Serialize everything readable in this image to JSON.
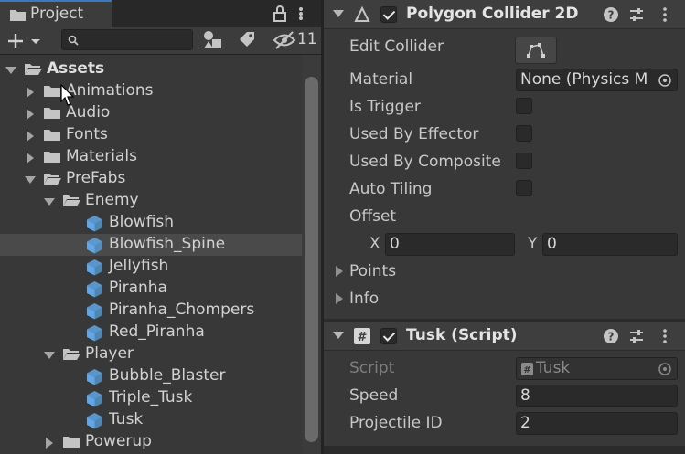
{
  "project": {
    "tab_title": "Project",
    "hidden_count": "11",
    "search_placeholder": "",
    "tree": [
      {
        "label": "Assets",
        "type": "folder",
        "expanded": true,
        "depth": 0,
        "bold": true
      },
      {
        "label": "Animations",
        "type": "folder",
        "expanded": false,
        "depth": 1
      },
      {
        "label": "Audio",
        "type": "folder",
        "expanded": false,
        "depth": 1
      },
      {
        "label": "Fonts",
        "type": "folder",
        "expanded": false,
        "depth": 1
      },
      {
        "label": "Materials",
        "type": "folder",
        "expanded": false,
        "depth": 1
      },
      {
        "label": "PreFabs",
        "type": "folder",
        "expanded": true,
        "depth": 1
      },
      {
        "label": "Enemy",
        "type": "folder",
        "expanded": true,
        "depth": 2
      },
      {
        "label": "Blowfish",
        "type": "prefab",
        "depth": 3
      },
      {
        "label": "Blowfish_Spine",
        "type": "prefab",
        "depth": 3,
        "selected": true
      },
      {
        "label": "Jellyfish",
        "type": "prefab",
        "depth": 3
      },
      {
        "label": "Piranha",
        "type": "prefab",
        "depth": 3
      },
      {
        "label": "Piranha_Chompers",
        "type": "prefab",
        "depth": 3
      },
      {
        "label": "Red_Piranha",
        "type": "prefab",
        "depth": 3
      },
      {
        "label": "Player",
        "type": "folder",
        "expanded": true,
        "depth": 2
      },
      {
        "label": "Bubble_Blaster",
        "type": "prefab",
        "depth": 3
      },
      {
        "label": "Triple_Tusk",
        "type": "prefab",
        "depth": 3
      },
      {
        "label": "Tusk",
        "type": "prefab",
        "depth": 3
      },
      {
        "label": "Powerup",
        "type": "folder",
        "expanded": false,
        "depth": 2
      }
    ]
  },
  "inspector": {
    "polygon_collider": {
      "title": "Polygon Collider 2D",
      "enabled": true,
      "edit_collider_label": "Edit Collider",
      "material_label": "Material",
      "material_value": "None (Physics M",
      "is_trigger_label": "Is Trigger",
      "used_by_effector_label": "Used By Effector",
      "used_by_composite_label": "Used By Composite",
      "auto_tiling_label": "Auto Tiling",
      "offset_label": "Offset",
      "offset_x_label": "X",
      "offset_x_value": "0",
      "offset_y_label": "Y",
      "offset_y_value": "0",
      "points_label": "Points",
      "info_label": "Info"
    },
    "tusk_script": {
      "title": "Tusk (Script)",
      "enabled": true,
      "script_label": "Script",
      "script_value": "Tusk",
      "speed_label": "Speed",
      "speed_value": "8",
      "projectile_id_label": "Projectile ID",
      "projectile_id_value": "2"
    }
  },
  "colors": {
    "panel_bg": "#383838",
    "selection": "#4a4a4a",
    "prefab_icon": "#5fa7e6",
    "tab_accent": "#3a79bb"
  }
}
